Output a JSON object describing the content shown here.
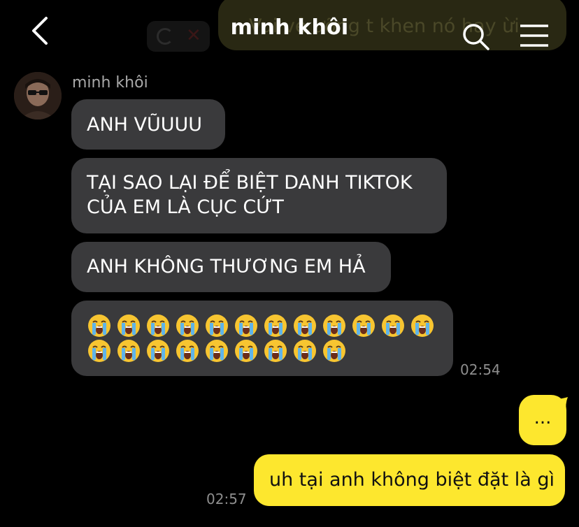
{
  "header": {
    "title": "minh khôi",
    "ghost_text": "Vui vẻ ưỡng t khen nó hay ừi",
    "back_icon": "chevron-left-icon",
    "search_icon": "search-icon",
    "menu_icon": "hamburger-menu-icon"
  },
  "conversation": {
    "sender_name": "minh khôi",
    "incoming": [
      {
        "text": "ANH VŨUUU"
      },
      {
        "text": "TẠI SAO LẠI ĐỂ BIỆT DANH TIKTOK CỦA EM LÀ CỤC CỨT"
      },
      {
        "text": "ANH KHÔNG THƯƠNG EM HẢ"
      },
      {
        "emoji": "loudly-crying-face-emoji",
        "row1_count": 12,
        "row2_count": 9
      }
    ],
    "incoming_time": "02:54",
    "outgoing": [
      {
        "text": "..."
      },
      {
        "text": "uh tại anh không biệt đặt là gì"
      }
    ],
    "outgoing_time": "02:57"
  },
  "colors": {
    "background": "#000000",
    "incoming_bubble": "#3a3a3c",
    "outgoing_bubble": "#fde72e",
    "timestamp": "#8e8e8e"
  }
}
